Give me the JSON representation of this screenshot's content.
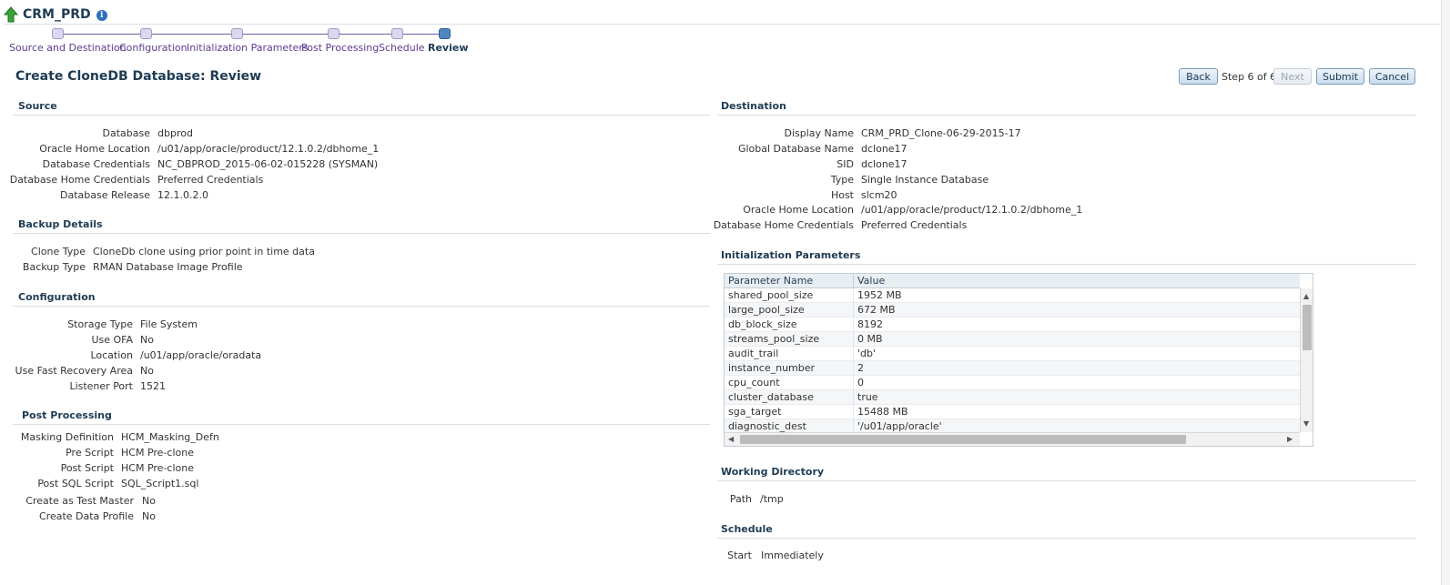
{
  "header": {
    "title": "CRM_PRD",
    "info_icon": "i"
  },
  "train": {
    "steps": [
      "Source and Destination",
      "Configuration",
      "Initialization Parameters",
      "Post Processing",
      "Schedule",
      "Review"
    ],
    "current": 5
  },
  "page_title": "Create CloneDB Database: Review",
  "buttons": {
    "back": "Back",
    "step": "Step 6 of 6",
    "next": "Next",
    "submit": "Submit",
    "cancel": "Cancel"
  },
  "source": {
    "heading": "Source",
    "rows": [
      {
        "label": "Database",
        "value": "dbprod"
      },
      {
        "label": "Oracle Home Location",
        "value": "/u01/app/oracle/product/12.1.0.2/dbhome_1"
      },
      {
        "label": "Database Credentials",
        "value": "NC_DBPROD_2015-06-02-015228 (SYSMAN)"
      },
      {
        "label": "Database Home Credentials",
        "value": "Preferred Credentials"
      },
      {
        "label": "Database Release",
        "value": "12.1.0.2.0"
      }
    ]
  },
  "backup": {
    "heading": "Backup Details",
    "rows": [
      {
        "label": "Clone Type",
        "value": "CloneDb clone using prior point in time data"
      },
      {
        "label": "Backup Type",
        "value": "RMAN Database Image Profile"
      }
    ]
  },
  "configuration": {
    "heading": "Configuration",
    "rows": [
      {
        "label": "Storage Type",
        "value": "File System"
      },
      {
        "label": "Use OFA",
        "value": "No"
      },
      {
        "label": "Location",
        "value": "/u01/app/oracle/oradata"
      },
      {
        "label": "Use Fast Recovery Area",
        "value": "No"
      },
      {
        "label": "Listener Port",
        "value": "1521"
      }
    ]
  },
  "post_processing": {
    "heading": "Post Processing",
    "rows": [
      {
        "label": "Masking Definition",
        "value": "HCM_Masking_Defn"
      },
      {
        "label": "Pre Script",
        "value": "HCM Pre-clone"
      },
      {
        "label": "Post Script",
        "value": "HCM Pre-clone"
      },
      {
        "label": "Post SQL Script",
        "value": "SQL_Script1.sql"
      },
      {
        "label": "Create as Test Master",
        "value": "No"
      },
      {
        "label": "Create Data Profile",
        "value": "No"
      }
    ]
  },
  "destination": {
    "heading": "Destination",
    "rows": [
      {
        "label": "Display Name",
        "value": "CRM_PRD_Clone-06-29-2015-17"
      },
      {
        "label": "Global Database Name",
        "value": "dclone17"
      },
      {
        "label": "SID",
        "value": "dclone17"
      },
      {
        "label": "Type",
        "value": "Single Instance Database"
      },
      {
        "label": "Host",
        "value": "slcm20"
      },
      {
        "label": "Oracle Home Location",
        "value": "/u01/app/oracle/product/12.1.0.2/dbhome_1"
      },
      {
        "label": "Database Home Credentials",
        "value": "Preferred Credentials"
      }
    ]
  },
  "init_params": {
    "heading": "Initialization Parameters",
    "columns": [
      "Parameter Name",
      "Value"
    ],
    "rows": [
      [
        "shared_pool_size",
        "1952 MB"
      ],
      [
        "large_pool_size",
        "672 MB"
      ],
      [
        "db_block_size",
        "8192"
      ],
      [
        "streams_pool_size",
        "0 MB"
      ],
      [
        "audit_trail",
        "'db'"
      ],
      [
        "instance_number",
        "2"
      ],
      [
        "cpu_count",
        "0"
      ],
      [
        "cluster_database",
        "true"
      ],
      [
        "sga_target",
        "15488 MB"
      ],
      [
        "diagnostic_dest",
        "'/u01/app/oracle'"
      ]
    ]
  },
  "working_directory": {
    "heading": "Working Directory",
    "label": "Path",
    "value": "/tmp"
  },
  "schedule": {
    "heading": "Schedule",
    "label": "Start",
    "value": "Immediately"
  }
}
